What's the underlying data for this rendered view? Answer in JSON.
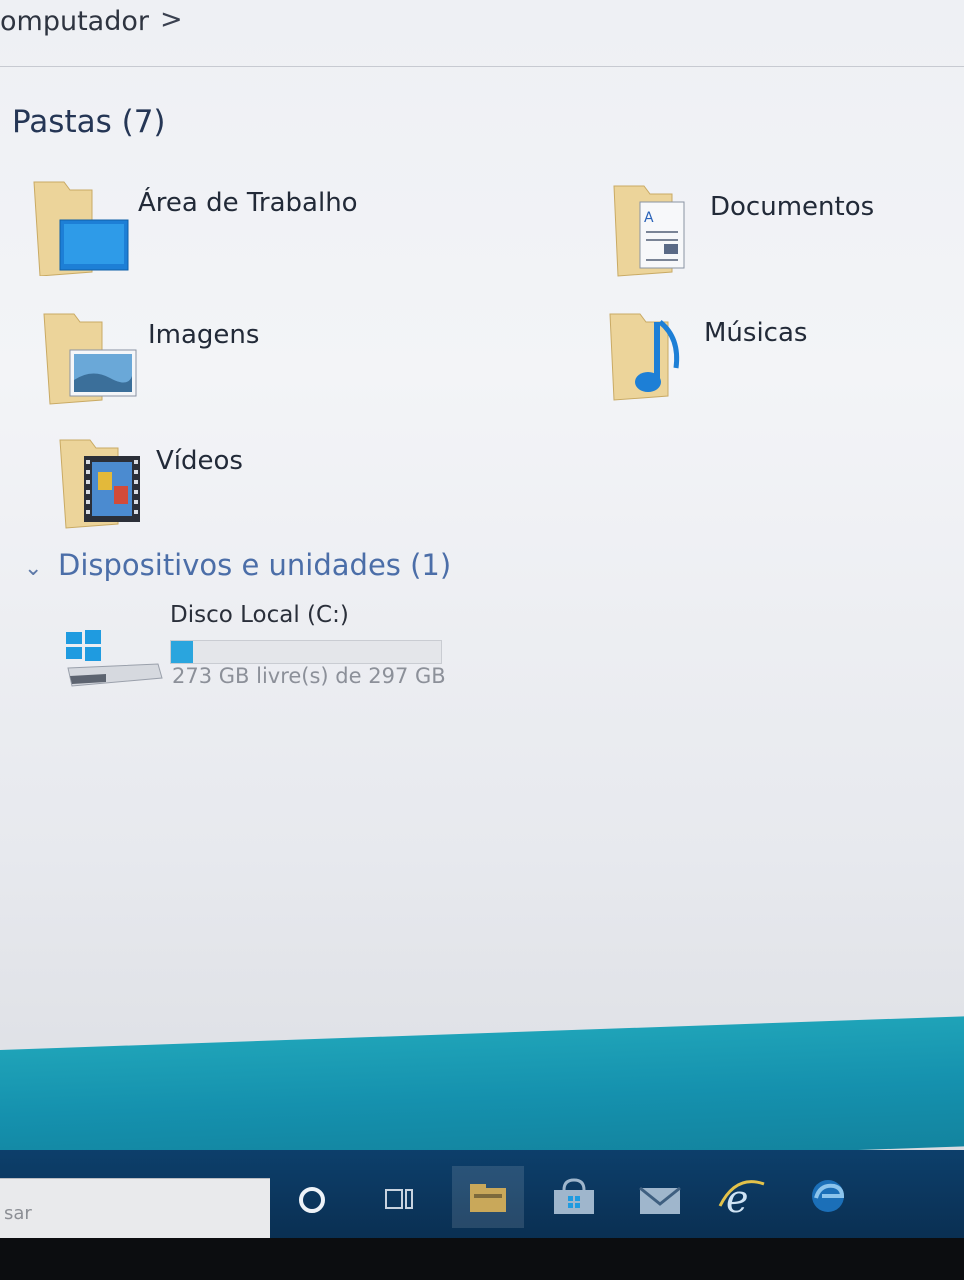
{
  "address_bar": {
    "breadcrumb": "omputador",
    "chevron": ">"
  },
  "groups": {
    "folders_header": "Pastas (7)",
    "devices_header": "Dispositivos e unidades (1)"
  },
  "folders": [
    {
      "label": "Área de Trabalho",
      "icon": "desktop-folder-icon"
    },
    {
      "label": "Documentos",
      "icon": "documents-folder-icon"
    },
    {
      "label": "Imagens",
      "icon": "pictures-folder-icon"
    },
    {
      "label": "Músicas",
      "icon": "music-folder-icon"
    },
    {
      "label": "Vídeos",
      "icon": "videos-folder-icon"
    }
  ],
  "drives": [
    {
      "label": "Disco Local (C:)",
      "free_text": "273 GB livre(s) de 297 GB",
      "used_fraction": 0.081,
      "icon": "windows-drive-icon"
    }
  ],
  "taskbar": {
    "search_placeholder": "sar",
    "buttons": [
      "cortana-icon",
      "task-view-icon",
      "file-explorer-icon",
      "store-icon",
      "mail-icon",
      "ie-icon",
      "edge-icon"
    ]
  },
  "colors": {
    "accent": "#2aa5de",
    "taskbar": "#0d3f6b",
    "teal_band": "#1591ae",
    "folder_yellow": "#e8c77a"
  }
}
